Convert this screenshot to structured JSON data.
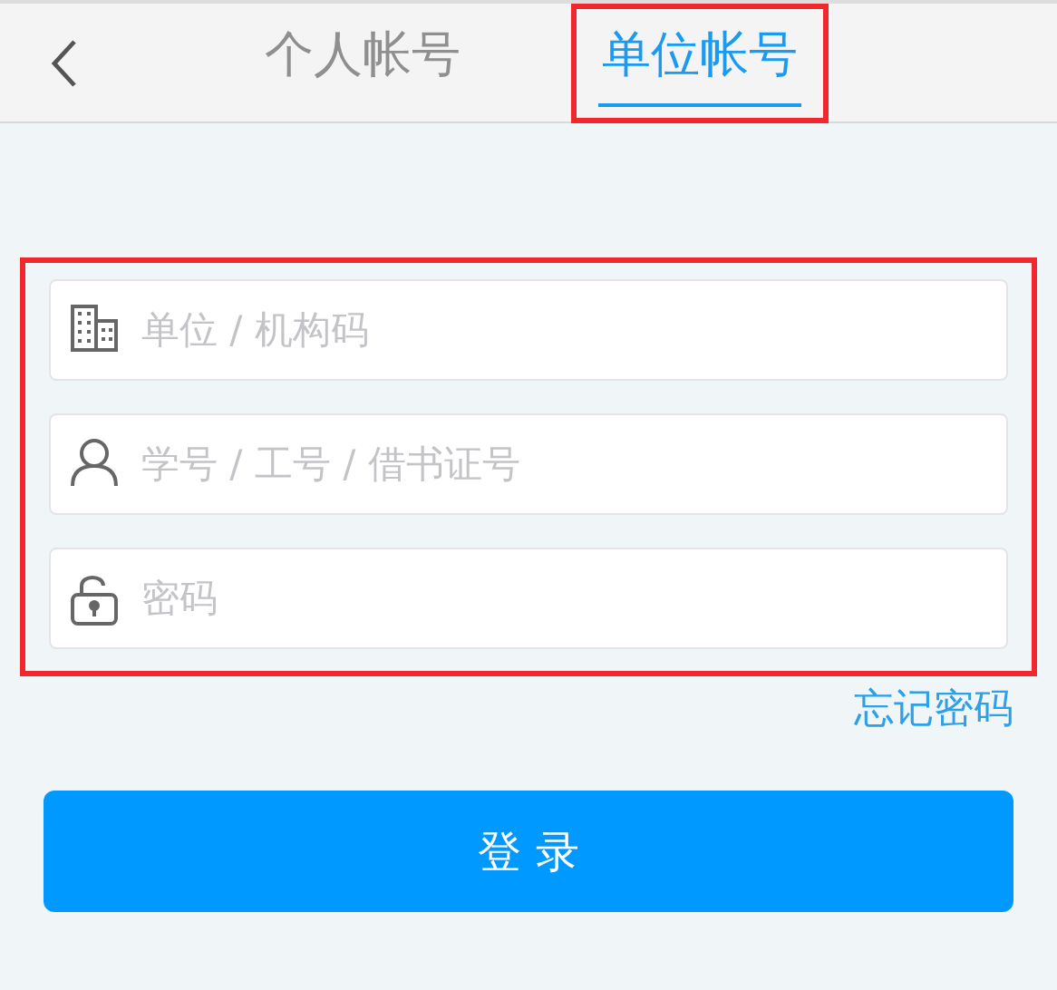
{
  "tabs": [
    {
      "label": "个人帐号",
      "selected": false,
      "highlighted": false
    },
    {
      "label": "单位帐号",
      "selected": true,
      "highlighted": true
    }
  ],
  "form": {
    "highlighted": true,
    "fields": [
      {
        "kind": "building",
        "placeholder": "单位 / 机构码"
      },
      {
        "kind": "person",
        "placeholder": "学号 / 工号 / 借书证号"
      },
      {
        "kind": "lock",
        "placeholder": "密码"
      }
    ]
  },
  "forgot_link": "忘记密码",
  "login_button": "登 录"
}
